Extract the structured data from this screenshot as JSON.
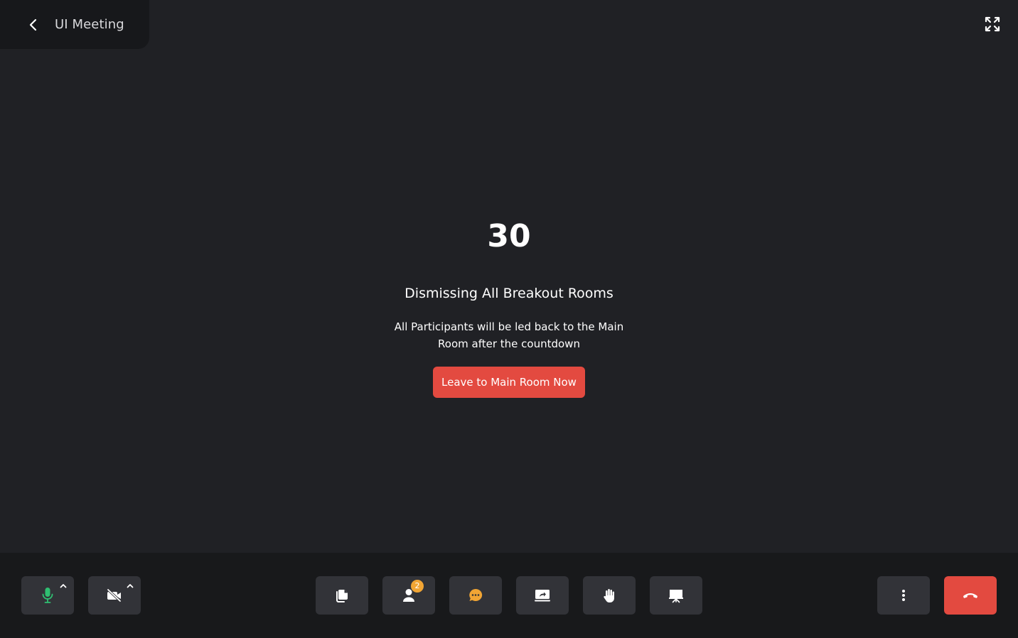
{
  "header": {
    "back_icon": "chevron-left-icon",
    "meeting_title": "UI Meeting",
    "fullscreen_icon": "fullscreen-icon"
  },
  "breakout": {
    "countdown": "30",
    "heading": "Dismissing All Breakout Rooms",
    "description": "All Participants will be led back to the Main Room after the countdown",
    "leave_button_label": "Leave to Main Room Now"
  },
  "toolbar": {
    "mic": {
      "icon": "microphone-icon",
      "state": "on",
      "color": "#2fbf71"
    },
    "camera": {
      "icon": "camera-off-icon",
      "state": "off"
    },
    "buttons": [
      {
        "icon": "copy-pages-icon"
      },
      {
        "icon": "participants-icon",
        "badge": "2"
      },
      {
        "icon": "chat-icon",
        "color": "#f1a534"
      },
      {
        "icon": "share-screen-icon"
      },
      {
        "icon": "raise-hand-icon"
      },
      {
        "icon": "whiteboard-icon"
      }
    ],
    "more_icon": "more-vertical-icon",
    "end_call": {
      "icon": "end-call-icon",
      "color": "#e34a40"
    }
  },
  "colors": {
    "background": "#202125",
    "toolbar_background": "#18191b",
    "button_background": "#323338",
    "accent_red": "#e34a40",
    "accent_green": "#2fbf71",
    "accent_orange": "#f1a534"
  }
}
